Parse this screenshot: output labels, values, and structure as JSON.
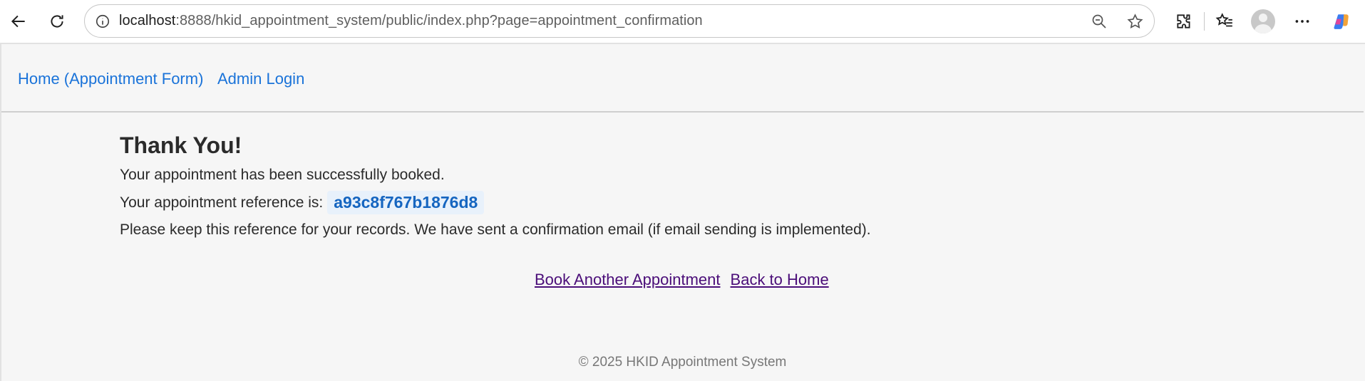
{
  "browser": {
    "url_host": "localhost",
    "url_rest": ":8888/hkid_appointment_system/public/index.php?page=appointment_confirmation"
  },
  "nav": {
    "home_label": "Home (Appointment Form)",
    "admin_label": "Admin Login"
  },
  "confirmation": {
    "heading": "Thank You!",
    "success_text": "Your appointment has been successfully booked.",
    "reference_label": "Your appointment reference is:",
    "reference_code": "a93c8f767b1876d8",
    "note": "Please keep this reference for your records. We have sent a confirmation email (if email sending is implemented)."
  },
  "actions": {
    "book_another": "Book Another Appointment",
    "back_home": "Back to Home"
  },
  "footer": {
    "text": "© 2025 HKID Appointment System"
  },
  "colors": {
    "link": "#1a73d9",
    "visited_link": "#4b0e79",
    "reference_text": "#1565c0",
    "reference_bg": "#e8f1fb",
    "page_bg": "#f6f6f6"
  }
}
